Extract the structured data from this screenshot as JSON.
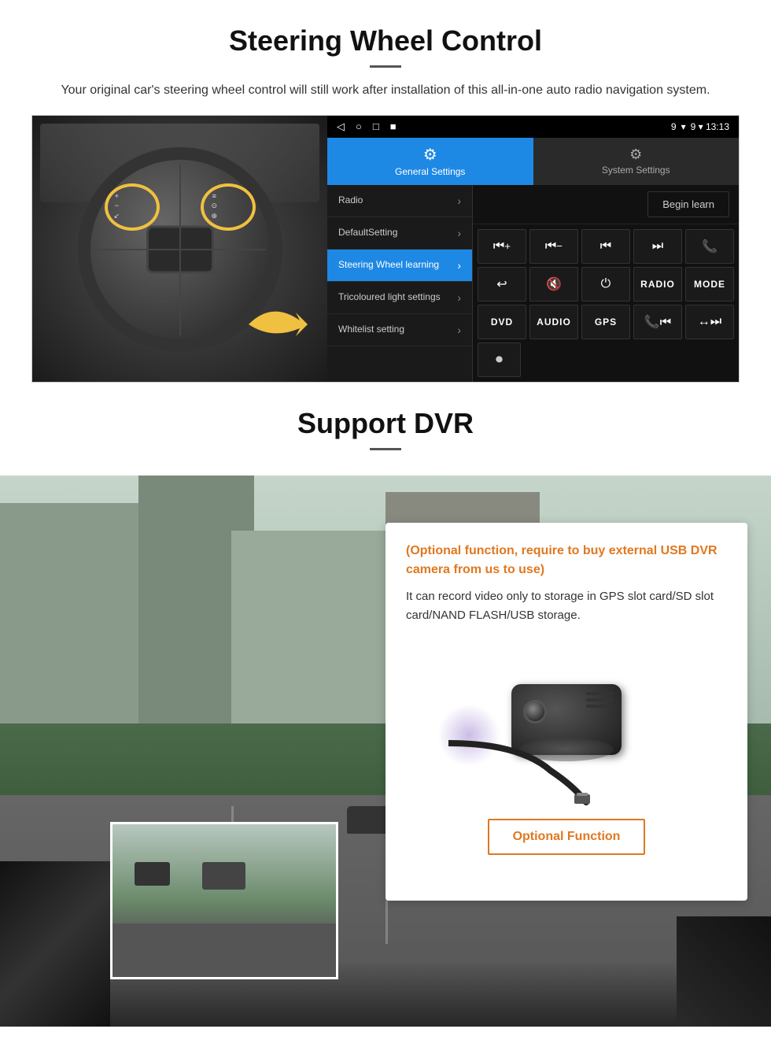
{
  "section1": {
    "title": "Steering Wheel Control",
    "description": "Your original car's steering wheel control will still work after installation of this all-in-one auto radio navigation system.",
    "statusBar": {
      "navIcons": [
        "◁",
        "○",
        "□",
        "■"
      ],
      "rightText": "9 ▾ 13:13"
    },
    "tabs": {
      "general": {
        "label": "General Settings",
        "icon": "⚙"
      },
      "system": {
        "label": "System Settings",
        "icon": "⚙"
      }
    },
    "menuItems": [
      {
        "label": "Radio",
        "active": false
      },
      {
        "label": "DefaultSetting",
        "active": false
      },
      {
        "label": "Steering Wheel learning",
        "active": true
      },
      {
        "label": "Tricoloured light settings",
        "active": false
      },
      {
        "label": "Whitelist setting",
        "active": false
      }
    ],
    "beginLearnBtn": "Begin learn",
    "controlButtons": {
      "row1": [
        "⏮+",
        "⏮-",
        "⏮",
        "⏭",
        "📞"
      ],
      "row2": [
        "↩",
        "🔇",
        "⏻",
        "RADIO",
        "MODE"
      ],
      "row3": [
        "DVD",
        "AUDIO",
        "GPS",
        "📞⏮",
        "↔⏭"
      ]
    },
    "bottomBtn": "📷"
  },
  "section2": {
    "title": "Support DVR",
    "optionalText": "(Optional function, require to buy external USB DVR camera from us to use)",
    "descText": "It can record video only to storage in GPS slot card/SD slot card/NAND FLASH/USB storage.",
    "optionalFunctionBtn": "Optional Function"
  }
}
